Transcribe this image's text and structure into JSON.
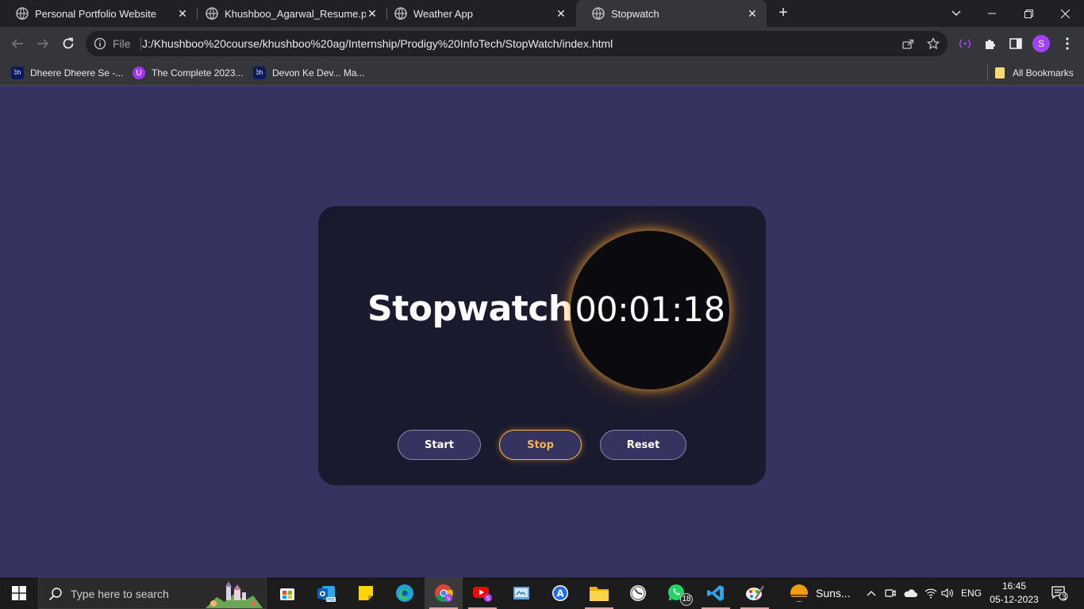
{
  "browser": {
    "tabs": [
      {
        "title": "Personal Portfolio Website",
        "active": false
      },
      {
        "title": "Khushboo_Agarwal_Resume.pdf",
        "active": false
      },
      {
        "title": "Weather App",
        "active": false
      },
      {
        "title": "Stopwatch",
        "active": true
      }
    ],
    "address": {
      "scheme_label": "File",
      "url": "J:/Khushboo%20course/khushboo%20ag/Internship/Prodigy%20InfoTech/StopWatch/index.html"
    },
    "profile_initial": "S",
    "bookmarks": [
      {
        "label": "Dheere Dheere Se -...",
        "icon": "dh-logo-icon"
      },
      {
        "label": "The Complete 2023...",
        "icon": "udemy-icon"
      },
      {
        "label": "Devon Ke Dev... Ma...",
        "icon": "dh-logo-icon"
      }
    ],
    "all_bookmarks_label": "All Bookmarks"
  },
  "stopwatch": {
    "title": "Stopwatch",
    "time": "00:01:18",
    "buttons": {
      "start": "Start",
      "stop": "Stop",
      "reset": "Reset"
    }
  },
  "colors": {
    "page_bg": "#35335f",
    "card_bg": "#1a1a2e",
    "clock_bg": "#0a0a0f",
    "accent_glow": "#ffb347"
  },
  "taskbar": {
    "search_placeholder": "Type here to search",
    "whatsapp_badge": "18",
    "weather_label": "Suns...",
    "language": "ENG",
    "time": "16:45",
    "date": "05-12-2023",
    "notifications_count": "3"
  }
}
